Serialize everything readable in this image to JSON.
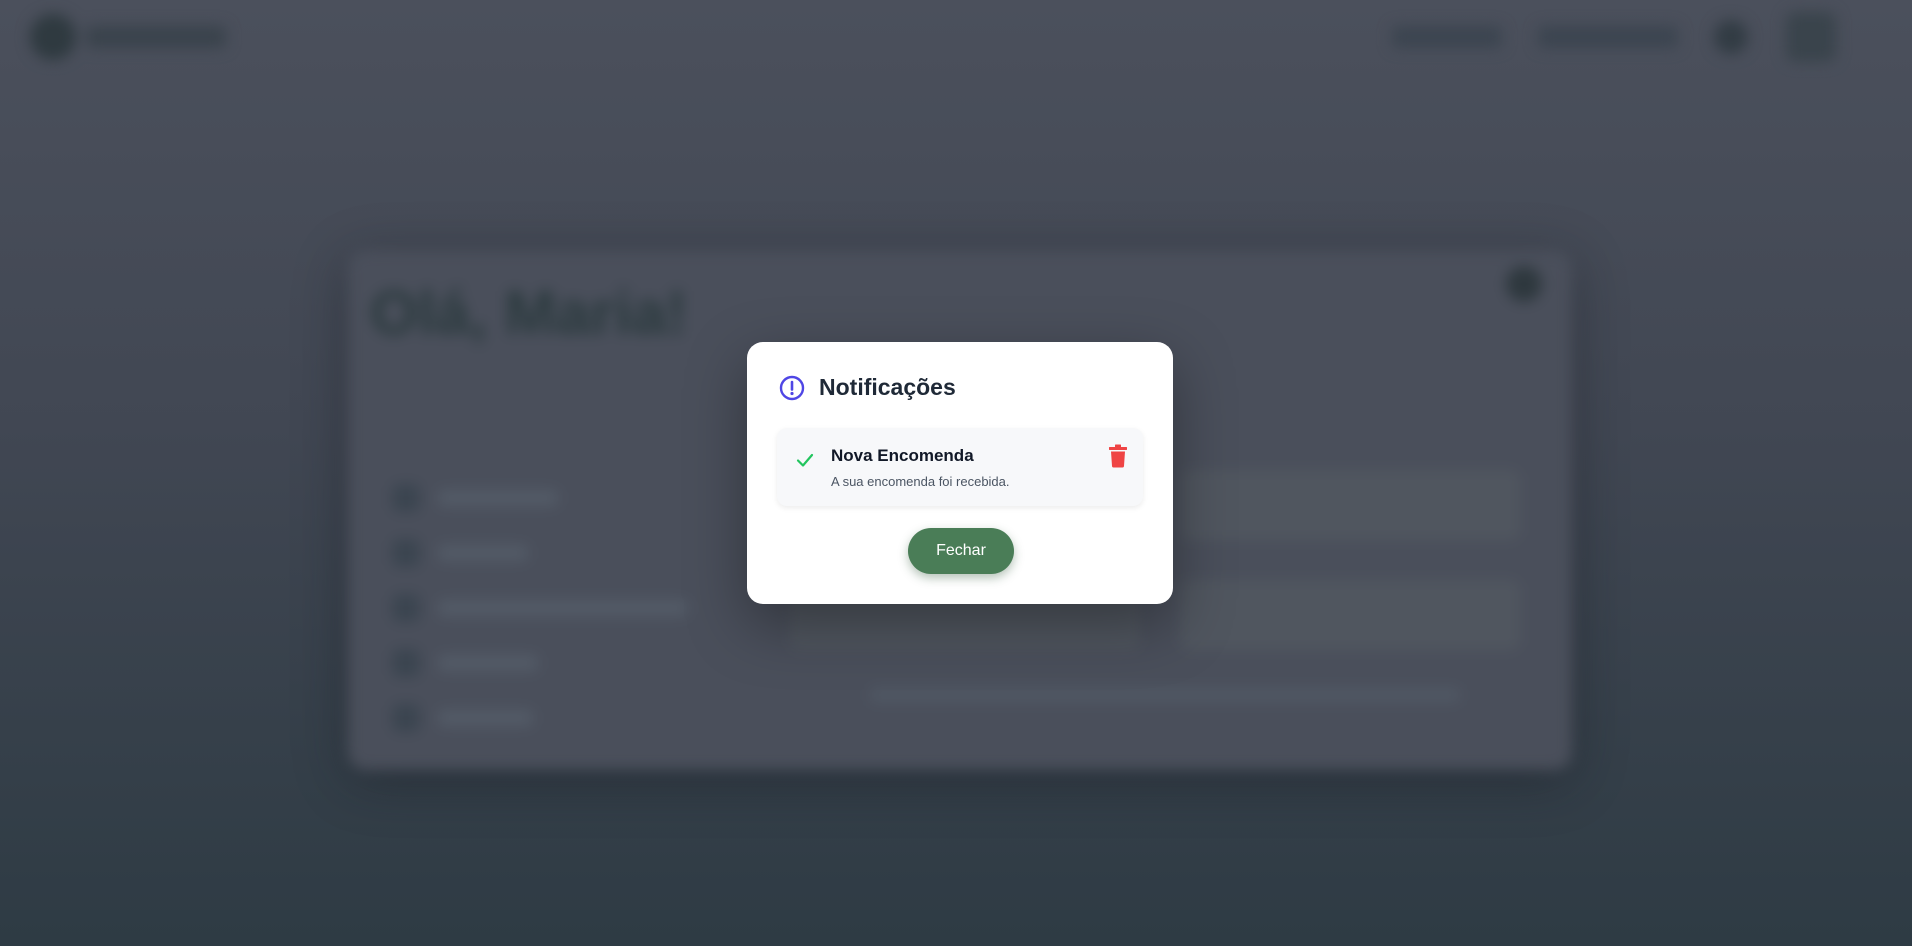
{
  "background": {
    "greeting": "Olá, Maria!"
  },
  "modal": {
    "title": "Notificações",
    "title_icon": "alert-circle-icon",
    "notifications": [
      {
        "status_icon": "check-icon",
        "title": "Nova Encomenda",
        "text": "A sua encomenda foi recebida.",
        "action_icon": "trash-icon"
      }
    ],
    "close_label": "Fechar"
  },
  "colors": {
    "accent_icon": "#4f46e5",
    "success": "#22c55e",
    "danger": "#ef4444",
    "button": "#4a7d57"
  }
}
